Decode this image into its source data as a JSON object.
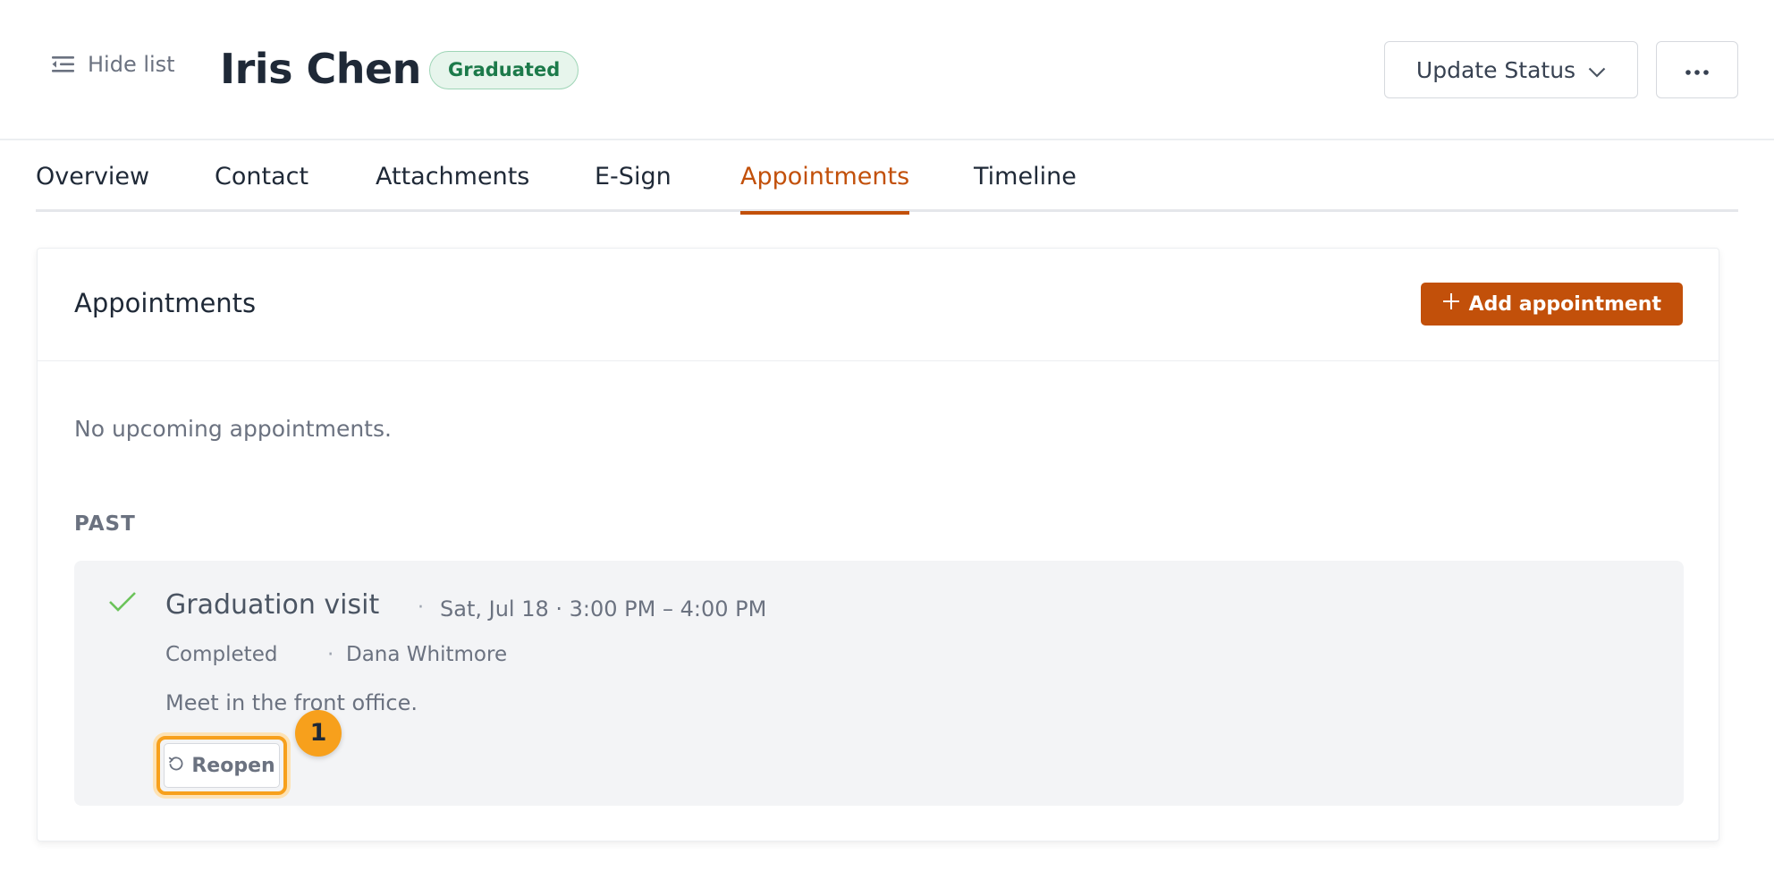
{
  "header": {
    "hide_list_label": "Hide list",
    "student_name": "Iris Chen",
    "status_badge": "Graduated",
    "update_status_label": "Update Status",
    "more_icon": "ellipsis-icon"
  },
  "tabs": [
    {
      "label": "Overview",
      "active": false
    },
    {
      "label": "Contact",
      "active": false
    },
    {
      "label": "Attachments",
      "active": false
    },
    {
      "label": "E-Sign",
      "active": false
    },
    {
      "label": "Appointments",
      "active": true
    },
    {
      "label": "Timeline",
      "active": false
    }
  ],
  "appointments": {
    "title": "Appointments",
    "add_button_label": "Add appointment",
    "empty_upcoming": "No upcoming appointments.",
    "past_label": "PAST",
    "past": [
      {
        "title": "Graduation visit",
        "separator": "·",
        "when": "Sat, Jul 18 · 3:00 PM – 4:00 PM",
        "status": "Completed",
        "owner": "Dana Whitmore",
        "note": "Meet in the front office.",
        "reopen_label": "Reopen"
      }
    ]
  },
  "annotation_marker": "1",
  "colors": {
    "accent": "#c2500a",
    "badge_green": "#1c7a4a",
    "highlight": "#f7a01c",
    "check": "#6bc35a"
  }
}
